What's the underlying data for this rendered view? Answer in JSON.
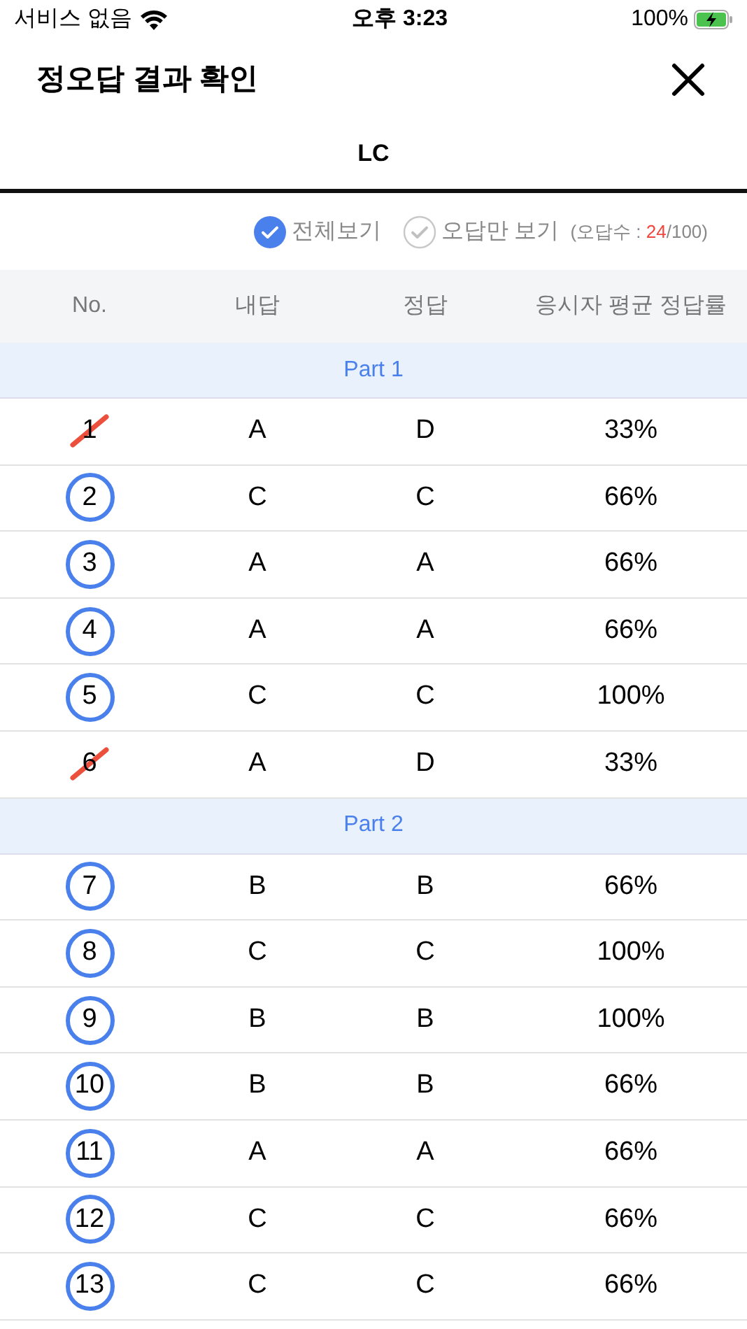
{
  "status_bar": {
    "carrier": "서비스 없음",
    "time": "오후 3:23",
    "battery": "100%"
  },
  "header": {
    "title": "정오답 결과 확인"
  },
  "tabs": [
    {
      "label": "LC",
      "selected": true
    }
  ],
  "filters": [
    {
      "label": "전체보기",
      "selected": true
    },
    {
      "label": "오답만 보기",
      "selected": false
    }
  ],
  "wrong_count": {
    "prefix": "(오답수 : ",
    "count": "24",
    "suffix": "/100)"
  },
  "table": {
    "columns": [
      "No.",
      "내답",
      "정답",
      "응시자 평균 정답률"
    ],
    "rows": [
      {
        "kind": "part",
        "label": "Part 1"
      },
      {
        "kind": "question",
        "number": "1",
        "correct": false,
        "my_answer": "A",
        "answer": "D",
        "rate": "33%"
      },
      {
        "kind": "question",
        "number": "2",
        "correct": true,
        "my_answer": "C",
        "answer": "C",
        "rate": "66%"
      },
      {
        "kind": "question",
        "number": "3",
        "correct": true,
        "my_answer": "A",
        "answer": "A",
        "rate": "66%"
      },
      {
        "kind": "question",
        "number": "4",
        "correct": true,
        "my_answer": "A",
        "answer": "A",
        "rate": "66%"
      },
      {
        "kind": "question",
        "number": "5",
        "correct": true,
        "my_answer": "C",
        "answer": "C",
        "rate": "100%"
      },
      {
        "kind": "question",
        "number": "6",
        "correct": false,
        "my_answer": "A",
        "answer": "D",
        "rate": "33%"
      },
      {
        "kind": "part",
        "label": "Part 2"
      },
      {
        "kind": "question",
        "number": "7",
        "correct": true,
        "my_answer": "B",
        "answer": "B",
        "rate": "66%"
      },
      {
        "kind": "question",
        "number": "8",
        "correct": true,
        "my_answer": "C",
        "answer": "C",
        "rate": "100%"
      },
      {
        "kind": "question",
        "number": "9",
        "correct": true,
        "my_answer": "B",
        "answer": "B",
        "rate": "100%"
      },
      {
        "kind": "question",
        "number": "10",
        "correct": true,
        "my_answer": "B",
        "answer": "B",
        "rate": "66%"
      },
      {
        "kind": "question",
        "number": "11",
        "correct": true,
        "my_answer": "A",
        "answer": "A",
        "rate": "66%"
      },
      {
        "kind": "question",
        "number": "12",
        "correct": true,
        "my_answer": "C",
        "answer": "C",
        "rate": "66%"
      },
      {
        "kind": "question",
        "number": "13",
        "correct": true,
        "my_answer": "C",
        "answer": "C",
        "rate": "66%"
      }
    ]
  }
}
